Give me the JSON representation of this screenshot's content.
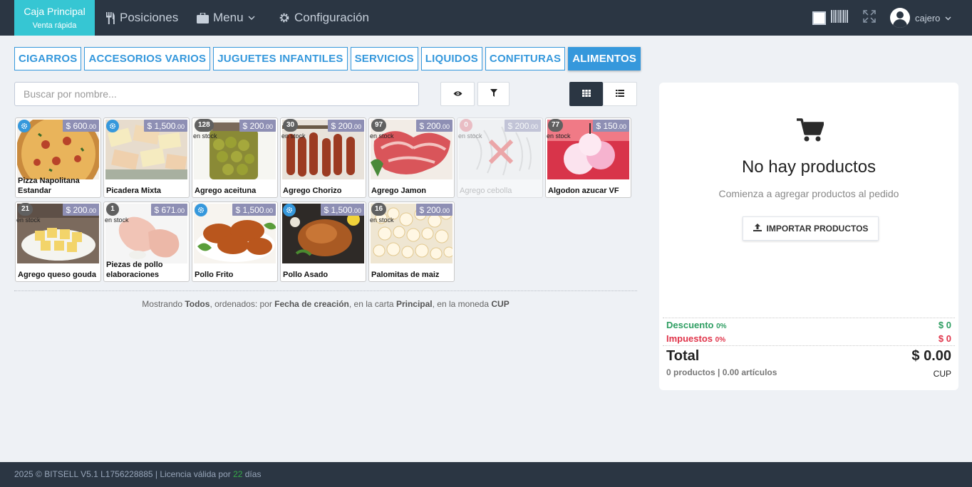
{
  "header": {
    "brand_title": "Caja Principal",
    "brand_subtitle": "Venta rápida",
    "nav": {
      "positions": "Posiciones",
      "menu": "Menu",
      "settings": "Configuración"
    },
    "user": "cajero"
  },
  "tabs": [
    "CIGARROS",
    "ACCESORIOS VARIOS",
    "JUGUETES INFANTILES",
    "SERVICIOS",
    "LIQUIDOS",
    "CONFITURAS",
    "ALIMENTOS"
  ],
  "active_tab": "ALIMENTOS",
  "search": {
    "placeholder": "Buscar por nombre...",
    "value": ""
  },
  "products": [
    {
      "name": "Pizza Napolitana Estandar",
      "price": "$ 600",
      "cents": ".00",
      "badge": "",
      "service": true,
      "stock_label": ""
    },
    {
      "name": "Picadera Mixta",
      "price": "$ 1,500",
      "cents": ".00",
      "badge": "",
      "service": true,
      "stock_label": ""
    },
    {
      "name": "Agrego aceituna",
      "price": "$ 200",
      "cents": ".00",
      "badge": "128",
      "service": false,
      "stock_label": "en stock"
    },
    {
      "name": "Agrego Chorizo",
      "price": "$ 200",
      "cents": ".00",
      "badge": "30",
      "service": false,
      "stock_label": "en stock"
    },
    {
      "name": "Agrego Jamon",
      "price": "$ 200",
      "cents": ".00",
      "badge": "97",
      "service": false,
      "stock_label": "en stock"
    },
    {
      "name": "Agrego cebolla",
      "price": "$ 200",
      "cents": ".00",
      "badge": "0",
      "service": false,
      "stock_label": "en stock",
      "disabled": true
    },
    {
      "name": "Algodon azucar VF",
      "price": "$ 150",
      "cents": ".00",
      "badge": "77",
      "service": false,
      "stock_label": "en stock"
    },
    {
      "name": "Agrego queso gouda",
      "price": "$ 200",
      "cents": ".00",
      "badge": "21",
      "service": false,
      "stock_label": "en stock"
    },
    {
      "name": "Piezas de pollo elaboraciones",
      "price": "$ 671",
      "cents": ".00",
      "badge": "1",
      "service": false,
      "stock_label": "en stock"
    },
    {
      "name": "Pollo Frito",
      "price": "$ 1,500",
      "cents": ".00",
      "badge": "",
      "service": true,
      "stock_label": ""
    },
    {
      "name": "Pollo Asado",
      "price": "$ 1,500",
      "cents": ".00",
      "badge": "",
      "service": true,
      "stock_label": ""
    },
    {
      "name": "Palomitas de maiz",
      "price": "$ 200",
      "cents": ".00",
      "badge": "16",
      "service": false,
      "stock_label": "en stock"
    }
  ],
  "info": {
    "p1": "Mostrando ",
    "all": "Todos",
    "p2": ", ordenados: por ",
    "sort": "Fecha de creación",
    "p3": ", en la carta ",
    "menu": "Principal",
    "p4": ", en la moneda ",
    "currency": "CUP"
  },
  "cart": {
    "empty_title": "No hay productos",
    "empty_subtitle": "Comienza a agregar productos al pedido",
    "import_label": "IMPORTAR PRODUCTOS",
    "discount_label": "Descuento",
    "discount_pct": "0%",
    "discount_value": "$ 0",
    "tax_label": "Impuestos",
    "tax_pct": "0%",
    "tax_value": "$ 0",
    "total_label": "Total",
    "total_value": "$ 0.00",
    "summary": "0 productos | 0.00 artículos",
    "currency": "CUP"
  },
  "footer": {
    "text": "2025 © BITSELL V5.1 L1756228885 | Licencia válida por ",
    "days": "22",
    "suffix": " días"
  },
  "colors": {
    "topbar": "#2b3643",
    "brand": "#36c6d3",
    "accent": "#3598dc",
    "discount": "#2e9e62",
    "tax": "#e0344a"
  }
}
